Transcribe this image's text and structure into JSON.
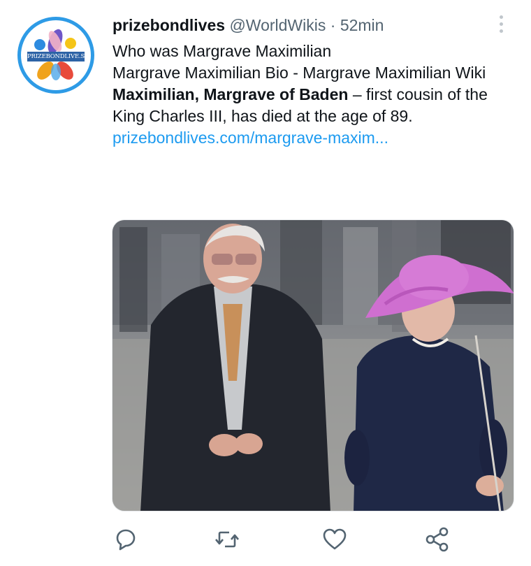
{
  "tweet": {
    "avatar_text": "PRIZEBONDLIVE.S",
    "display_name": "prizebondlives",
    "handle": "@WorldWikis",
    "separator": "·",
    "time": "52min",
    "lines": [
      "Who was Margrave Maximilian",
      "Margrave Maximilian Bio - Margrave Maximilian Wiki"
    ],
    "bold_text": "Maximilian, Margrave of Baden",
    "rest_text": " – first cousin of the King Charles III, has died at the age of 89.",
    "link": "prizebondlives.com/margrave-maxim..."
  },
  "actions": [
    {
      "name": "reply",
      "icon": "reply-icon"
    },
    {
      "name": "retweet",
      "icon": "retweet-icon"
    },
    {
      "name": "like",
      "icon": "heart-icon"
    },
    {
      "name": "share",
      "icon": "share-icon"
    }
  ],
  "colors": {
    "link": "#1d9bf0",
    "muted": "#536471",
    "avatar_ring": "#2e9be6"
  }
}
